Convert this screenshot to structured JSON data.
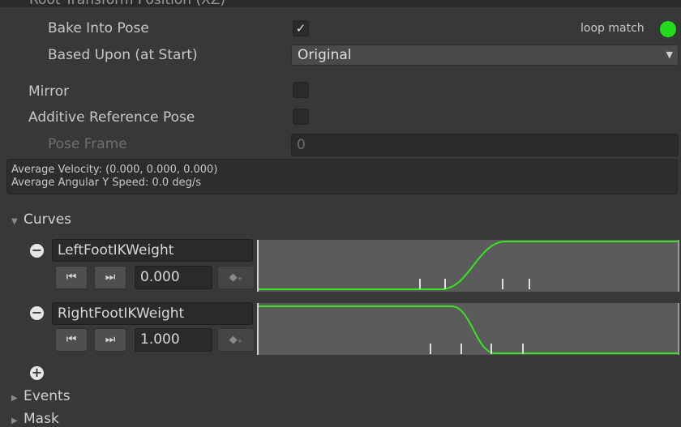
{
  "header": {
    "clip_title": "Root Transform Position (XZ)"
  },
  "root_position": {
    "bake_label": "Bake Into Pose",
    "bake_checked": true,
    "bake_check_glyph": "✓",
    "loop_match_label": "loop match",
    "loop_match_color": "#22dd1a",
    "based_upon_label": "Based Upon (at Start)",
    "based_upon_value": "Original"
  },
  "mirror": {
    "label": "Mirror",
    "checked": false
  },
  "additive": {
    "label": "Additive Reference Pose",
    "checked": false
  },
  "pose_frame": {
    "label": "Pose Frame",
    "value": "0"
  },
  "info": {
    "line1": "Average Velocity: (0.000, 0.000, 0.000)",
    "line2": "Average Angular Y Speed: 0.0 deg/s"
  },
  "sections": {
    "curves": "Curves",
    "events": "Events",
    "mask": "Mask"
  },
  "curves": [
    {
      "name": "LeftFootIKWeight",
      "value": "0.000",
      "curve_color": "#36e51f",
      "start_value": 0,
      "end_value": 1
    },
    {
      "name": "RightFootIKWeight",
      "value": "1.000",
      "curve_color": "#36e51f",
      "start_value": 1,
      "end_value": 0
    }
  ],
  "icons": {
    "prev_key": "previous-key-icon",
    "next_key": "next-key-icon",
    "add_key": "add-key-icon",
    "remove_curve": "minus-circle-icon",
    "add_curve": "plus-circle-icon",
    "foldout_open": "triangle-down-icon",
    "foldout_closed": "triangle-right-icon"
  }
}
